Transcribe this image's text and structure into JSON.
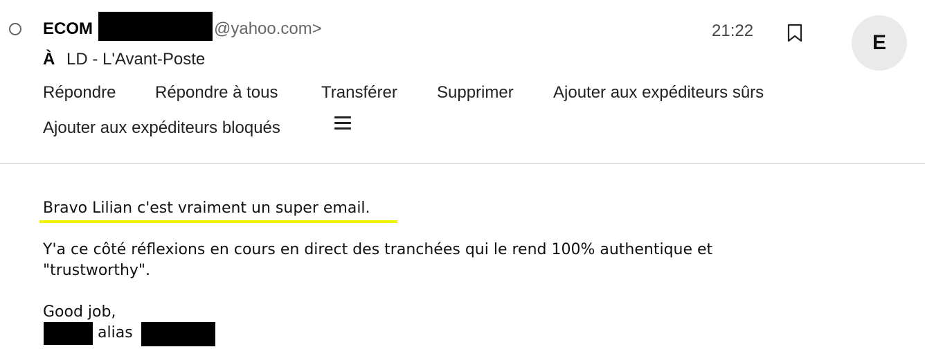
{
  "header": {
    "sender_name": "ECOM",
    "sender_email": "@yahoo.com>",
    "to_label": "À",
    "to_value": "LD - L'Avant-Poste",
    "time": "21:22",
    "avatar_initial": "E"
  },
  "actions": {
    "reply": "Répondre",
    "reply_all": "Répondre à tous",
    "forward": "Transférer",
    "delete": "Supprimer",
    "add_safe": "Ajouter aux expéditeurs sûrs",
    "add_blocked": "Ajouter aux expéditeurs bloqués"
  },
  "message": {
    "line1": "Bravo Lilian c'est vraiment un super email.",
    "line2": "Y'a ce côté réflexions en cours en direct des tranchées qui le rend 100% authentique et",
    "line3": "\"trustworthy\".",
    "line4": "Good job,",
    "alias": "alias"
  },
  "icons": {
    "status": "radio-circle-icon",
    "bookmark": "bookmark-icon",
    "menu": "hamburger-menu-icon"
  },
  "colors": {
    "highlight": "#f2f200",
    "avatar_bg": "#eaeaea"
  }
}
